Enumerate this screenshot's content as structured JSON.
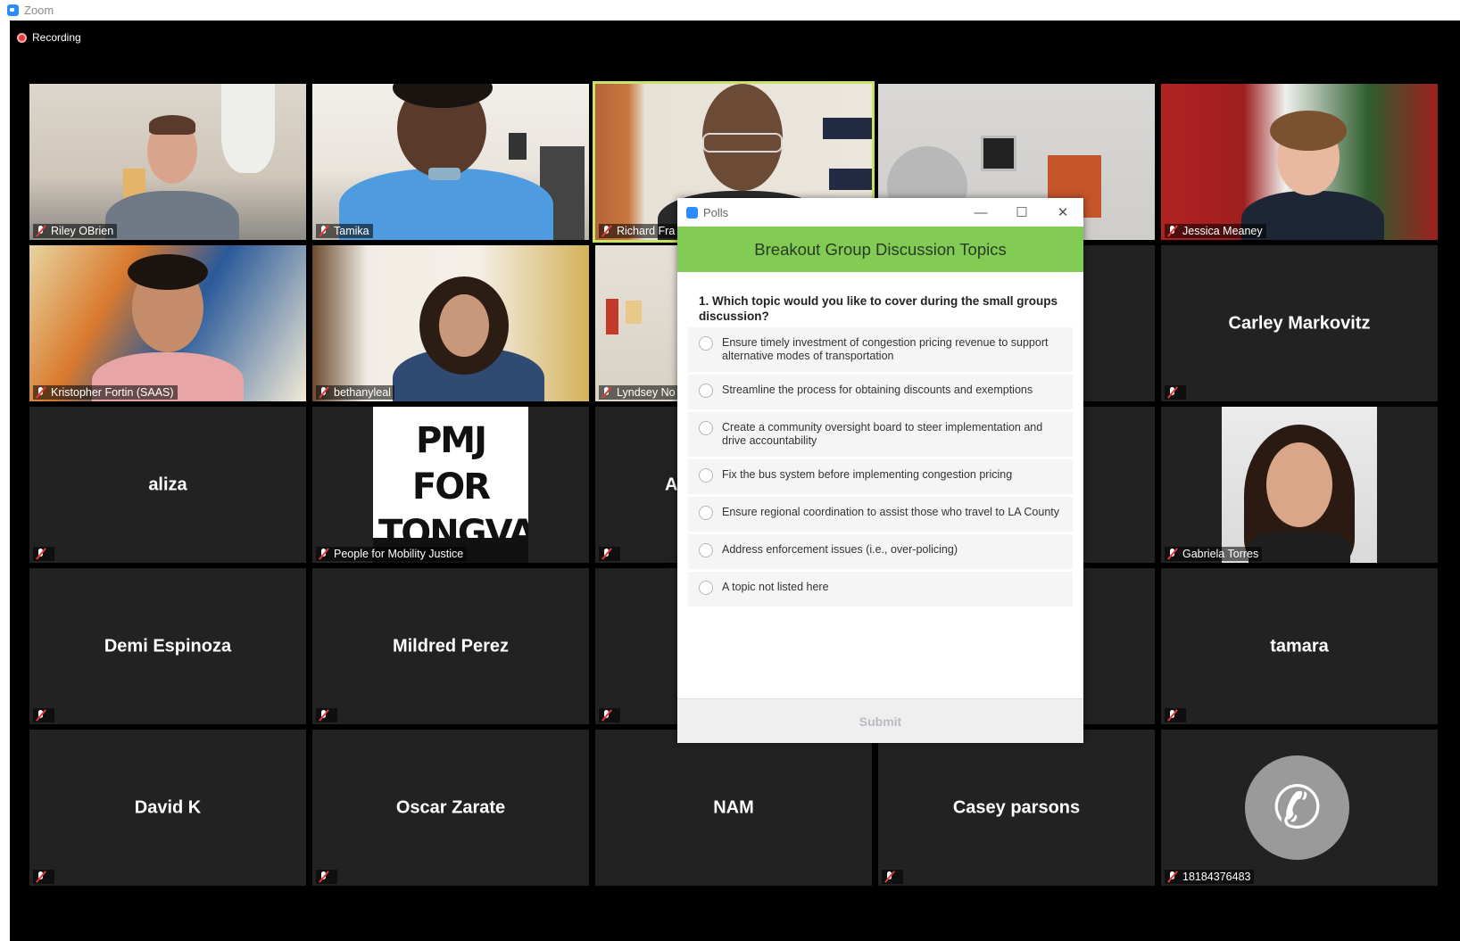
{
  "app": {
    "title": "Zoom"
  },
  "recording": {
    "label": "Recording"
  },
  "tiles": [
    {
      "name": "Riley OBrien",
      "video": true
    },
    {
      "name": "Tamika",
      "video": true
    },
    {
      "name": "Richard Fra",
      "video": true,
      "active": true
    },
    {
      "name": "",
      "video": true
    },
    {
      "name": "Jessica Meaney",
      "video": true
    },
    {
      "name": "Kristopher Fortin (SAAS)",
      "video": true
    },
    {
      "name": "bethanyleal",
      "video": true
    },
    {
      "name": "Lyndsey No",
      "video": true
    },
    {
      "name": "",
      "video": false
    },
    {
      "big": "Carley Markovitz"
    },
    {
      "big": "aliza"
    },
    {
      "name": "People for Mobility Justice",
      "image": "PMJ FOR TONGVA"
    },
    {
      "big": "A"
    },
    {
      "big": ""
    },
    {
      "name": "Gabriela Torres",
      "video": true
    },
    {
      "big": "Demi Espinoza"
    },
    {
      "big": "Mildred Perez"
    },
    {
      "big": ""
    },
    {
      "big": ""
    },
    {
      "big": "tamara"
    },
    {
      "big": "David K"
    },
    {
      "big": "Oscar Zarate"
    },
    {
      "big": "NAM"
    },
    {
      "big": "Casey parsons"
    },
    {
      "name": "18184376483",
      "phone": true
    }
  ],
  "poll": {
    "window_title": "Polls",
    "header": "Breakout Group Discussion Topics",
    "question": "1. Which topic would you like to cover during the small groups discussion?",
    "options": [
      "Ensure timely investment of congestion pricing revenue to support alternative modes of transportation",
      "Streamline the process for obtaining discounts and exemptions",
      "Create a community oversight board to steer implementation and drive accountability",
      "Fix the bus system before implementing congestion pricing",
      "Ensure regional coordination to assist those who travel to LA County",
      "Address enforcement issues (i.e., over-policing)",
      "A topic not listed here"
    ],
    "submit_label": "Submit"
  },
  "colors": {
    "poll_header": "#82cc56",
    "active_speaker_border": "#c8e36a",
    "recording_dot": "#e03c3c"
  }
}
